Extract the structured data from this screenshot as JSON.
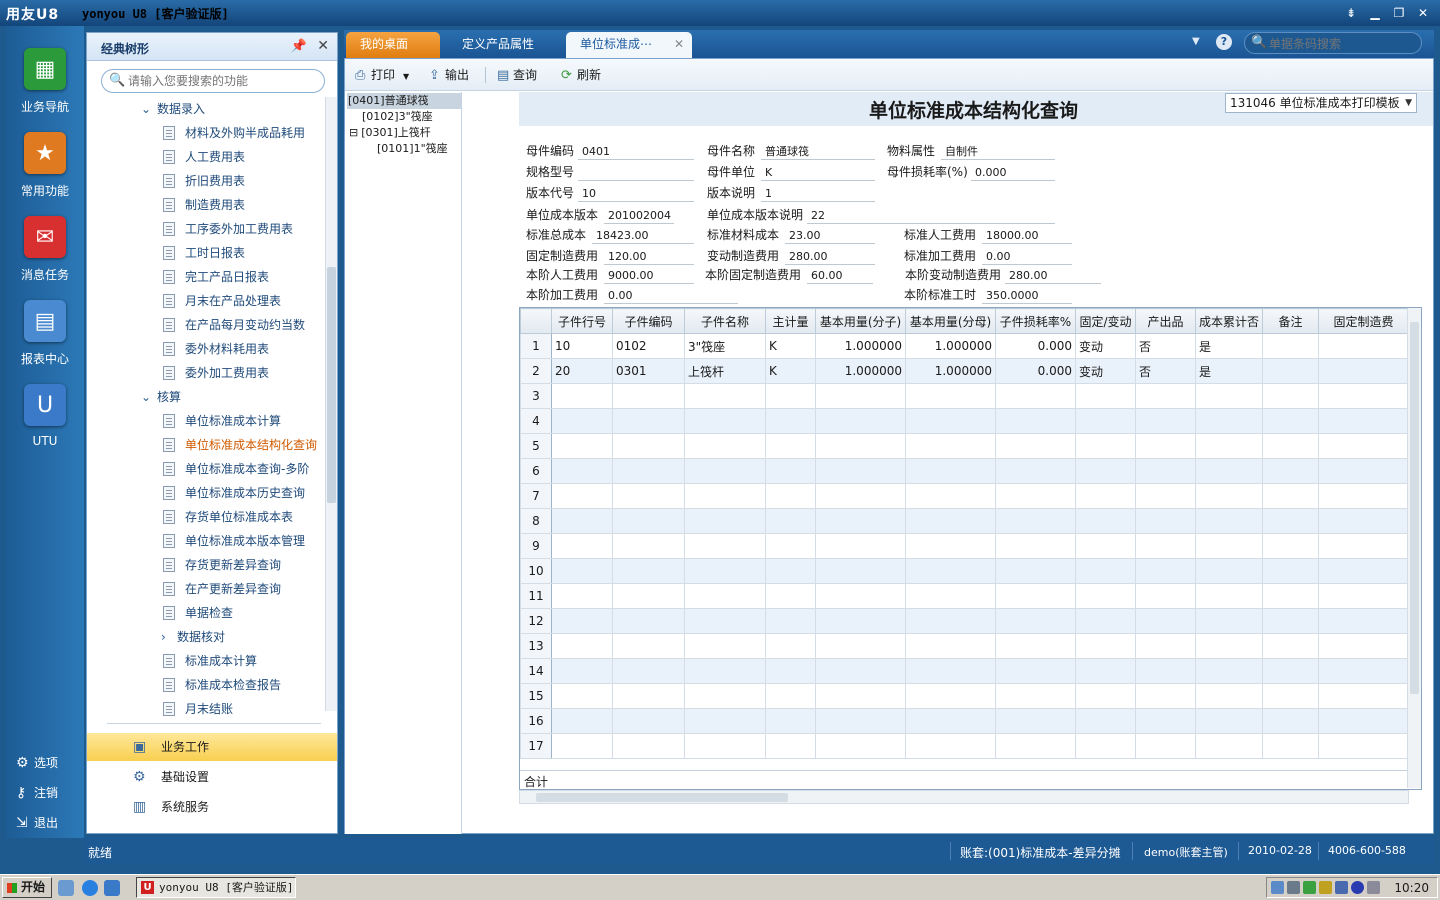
{
  "window": {
    "logo": "用友U8",
    "title": "yonyou U8 [客户验证版]"
  },
  "leftnav": {
    "items": [
      {
        "label": "业务导航",
        "icon": "business-nav-icon",
        "color": "#2a9a3a"
      },
      {
        "label": "常用功能",
        "icon": "star-icon",
        "color": "#e07a20"
      },
      {
        "label": "消息任务",
        "icon": "mail-icon",
        "color": "#d83030"
      },
      {
        "label": "报表中心",
        "icon": "report-icon",
        "color": "#4a8ad0"
      },
      {
        "label": "UTU",
        "icon": "utu-icon",
        "color": "#3a7ac8"
      }
    ],
    "system": [
      {
        "label": "选项",
        "icon": "gear-icon"
      },
      {
        "label": "注销",
        "icon": "key-icon"
      },
      {
        "label": "退出",
        "icon": "exit-icon"
      }
    ]
  },
  "tree": {
    "title": "经典树形",
    "search_placeholder": "请输入您要搜索的功能",
    "items": [
      {
        "label": "数据录入",
        "level": 1,
        "type": "folder",
        "expanded": true
      },
      {
        "label": "材料及外购半成品耗用",
        "level": 2,
        "type": "doc"
      },
      {
        "label": "人工费用表",
        "level": 2,
        "type": "doc"
      },
      {
        "label": "折旧费用表",
        "level": 2,
        "type": "doc"
      },
      {
        "label": "制造费用表",
        "level": 2,
        "type": "doc"
      },
      {
        "label": "工序委外加工费用表",
        "level": 2,
        "type": "doc"
      },
      {
        "label": "工时日报表",
        "level": 2,
        "type": "doc"
      },
      {
        "label": "完工产品日报表",
        "level": 2,
        "type": "doc"
      },
      {
        "label": "月末在产品处理表",
        "level": 2,
        "type": "doc"
      },
      {
        "label": "在产品每月变动约当数",
        "level": 2,
        "type": "doc"
      },
      {
        "label": "委外材料耗用表",
        "level": 2,
        "type": "doc"
      },
      {
        "label": "委外加工费用表",
        "level": 2,
        "type": "doc"
      },
      {
        "label": "核算",
        "level": 1,
        "type": "folder",
        "expanded": true
      },
      {
        "label": "单位标准成本计算",
        "level": 2,
        "type": "doc"
      },
      {
        "label": "单位标准成本结构化查询",
        "level": 2,
        "type": "doc",
        "selected": true
      },
      {
        "label": "单位标准成本查询-多阶",
        "level": 2,
        "type": "doc"
      },
      {
        "label": "单位标准成本历史查询",
        "level": 2,
        "type": "doc"
      },
      {
        "label": "存货单位标准成本表",
        "level": 2,
        "type": "doc"
      },
      {
        "label": "单位标准成本版本管理",
        "level": 2,
        "type": "doc"
      },
      {
        "label": "存货更新差异查询",
        "level": 2,
        "type": "doc"
      },
      {
        "label": "在产更新差异查询",
        "level": 2,
        "type": "doc"
      },
      {
        "label": "单据检查",
        "level": 2,
        "type": "doc"
      },
      {
        "label": "数据核对",
        "level": 2,
        "type": "folder",
        "expanded": false
      },
      {
        "label": "标准成本计算",
        "level": 2,
        "type": "doc"
      },
      {
        "label": "标准成本检查报告",
        "level": 2,
        "type": "doc"
      },
      {
        "label": "月末结账",
        "level": 2,
        "type": "doc"
      }
    ],
    "bottom": [
      {
        "label": "业务工作",
        "icon": "business-work-icon",
        "active": true
      },
      {
        "label": "基础设置",
        "icon": "settings-icon"
      },
      {
        "label": "系统服务",
        "icon": "system-service-icon"
      }
    ]
  },
  "tabs": [
    {
      "label": "我的桌面",
      "style": "orange"
    },
    {
      "label": "定义产品属性",
      "style": "normal"
    },
    {
      "label": "单位标准成⋯",
      "style": "active"
    }
  ],
  "tabsearch_placeholder": "单据条码搜索",
  "toolbar": {
    "print": "打印",
    "export": "输出",
    "query": "查询",
    "refresh": "刷新"
  },
  "bomtree": [
    {
      "label": "[0401]普通球筏",
      "level": 0,
      "selected": true
    },
    {
      "label": "[0102]3\"筏座",
      "level": 1
    },
    {
      "label": "[0301]上筏杆",
      "level": 1,
      "expander": "⊟"
    },
    {
      "label": "[0101]1\"筏座",
      "level": 2
    }
  ],
  "form": {
    "title": "单位标准成本结构化查询",
    "template": "131046 单位标准成本打印模板",
    "fields": {
      "parent_code": {
        "label": "母件编码",
        "value": "0401"
      },
      "parent_name": {
        "label": "母件名称",
        "value": "普通球筏"
      },
      "material_attr": {
        "label": "物料属性",
        "value": "自制件"
      },
      "spec": {
        "label": "规格型号",
        "value": ""
      },
      "parent_unit": {
        "label": "母件单位",
        "value": "K"
      },
      "parent_loss": {
        "label": "母件损耗率(%)",
        "value": "0.000"
      },
      "version_code": {
        "label": "版本代号",
        "value": "10"
      },
      "version_desc": {
        "label": "版本说明",
        "value": "1"
      },
      "unit_cost_version": {
        "label": "单位成本版本",
        "value": "201002004"
      },
      "unit_cost_version_desc": {
        "label": "单位成本版本说明",
        "value": "22"
      },
      "std_total_cost": {
        "label": "标准总成本",
        "value": "18423.00"
      },
      "std_material_cost": {
        "label": "标准材料成本",
        "value": "23.00"
      },
      "std_labor_cost": {
        "label": "标准人工费用",
        "value": "18000.00"
      },
      "fixed_mfg_cost": {
        "label": "固定制造费用",
        "value": "120.00"
      },
      "var_mfg_cost": {
        "label": "变动制造费用",
        "value": "280.00"
      },
      "std_process_cost": {
        "label": "标准加工费用",
        "value": "0.00"
      },
      "lvl_labor_cost": {
        "label": "本阶人工费用",
        "value": "9000.00"
      },
      "lvl_fixed_mfg": {
        "label": "本阶固定制造费用",
        "value": "60.00"
      },
      "lvl_var_mfg": {
        "label": "本阶变动制造费用",
        "value": "280.00"
      },
      "lvl_process_cost": {
        "label": "本阶加工费用",
        "value": "0.00"
      },
      "lvl_std_hours": {
        "label": "本阶标准工时",
        "value": "350.0000"
      }
    }
  },
  "grid": {
    "columns": [
      "",
      "子件行号",
      "子件编码",
      "子件名称",
      "主计量",
      "基本用量(分子)",
      "基本用量(分母)",
      "子件损耗率%",
      "固定/变动",
      "产出品",
      "成本累计否",
      "备注",
      "固定制造费"
    ],
    "rows": [
      [
        "1",
        "10",
        "0102",
        "3\"筏座",
        "K",
        "1.000000",
        "1.000000",
        "0.000",
        "变动",
        "否",
        "是",
        "",
        ""
      ],
      [
        "2",
        "20",
        "0301",
        "上筏杆",
        "K",
        "1.000000",
        "1.000000",
        "0.000",
        "变动",
        "否",
        "是",
        "",
        ""
      ],
      [
        "3",
        "",
        "",
        "",
        "",
        "",
        "",
        "",
        "",
        "",
        "",
        "",
        ""
      ],
      [
        "4",
        "",
        "",
        "",
        "",
        "",
        "",
        "",
        "",
        "",
        "",
        "",
        ""
      ],
      [
        "5",
        "",
        "",
        "",
        "",
        "",
        "",
        "",
        "",
        "",
        "",
        "",
        ""
      ],
      [
        "6",
        "",
        "",
        "",
        "",
        "",
        "",
        "",
        "",
        "",
        "",
        "",
        ""
      ],
      [
        "7",
        "",
        "",
        "",
        "",
        "",
        "",
        "",
        "",
        "",
        "",
        "",
        ""
      ],
      [
        "8",
        "",
        "",
        "",
        "",
        "",
        "",
        "",
        "",
        "",
        "",
        "",
        ""
      ],
      [
        "9",
        "",
        "",
        "",
        "",
        "",
        "",
        "",
        "",
        "",
        "",
        "",
        ""
      ],
      [
        "10",
        "",
        "",
        "",
        "",
        "",
        "",
        "",
        "",
        "",
        "",
        "",
        ""
      ],
      [
        "11",
        "",
        "",
        "",
        "",
        "",
        "",
        "",
        "",
        "",
        "",
        "",
        ""
      ],
      [
        "12",
        "",
        "",
        "",
        "",
        "",
        "",
        "",
        "",
        "",
        "",
        "",
        ""
      ],
      [
        "13",
        "",
        "",
        "",
        "",
        "",
        "",
        "",
        "",
        "",
        "",
        "",
        ""
      ],
      [
        "14",
        "",
        "",
        "",
        "",
        "",
        "",
        "",
        "",
        "",
        "",
        "",
        ""
      ],
      [
        "15",
        "",
        "",
        "",
        "",
        "",
        "",
        "",
        "",
        "",
        "",
        "",
        ""
      ],
      [
        "16",
        "",
        "",
        "",
        "",
        "",
        "",
        "",
        "",
        "",
        "",
        "",
        ""
      ],
      [
        "17",
        "",
        "",
        "",
        "",
        "",
        "",
        "",
        "",
        "",
        "",
        "",
        ""
      ]
    ],
    "total_label": "合计"
  },
  "status": {
    "left": "就绪",
    "account": "账套:(001)标准成本-差异分摊",
    "user": "demo(账套主管)",
    "date": "2010-02-28",
    "phone": "4006-600-588"
  },
  "taskbar": {
    "start": "开始",
    "task": "yonyou U8 [客户验证版]",
    "clock": "10:20"
  }
}
